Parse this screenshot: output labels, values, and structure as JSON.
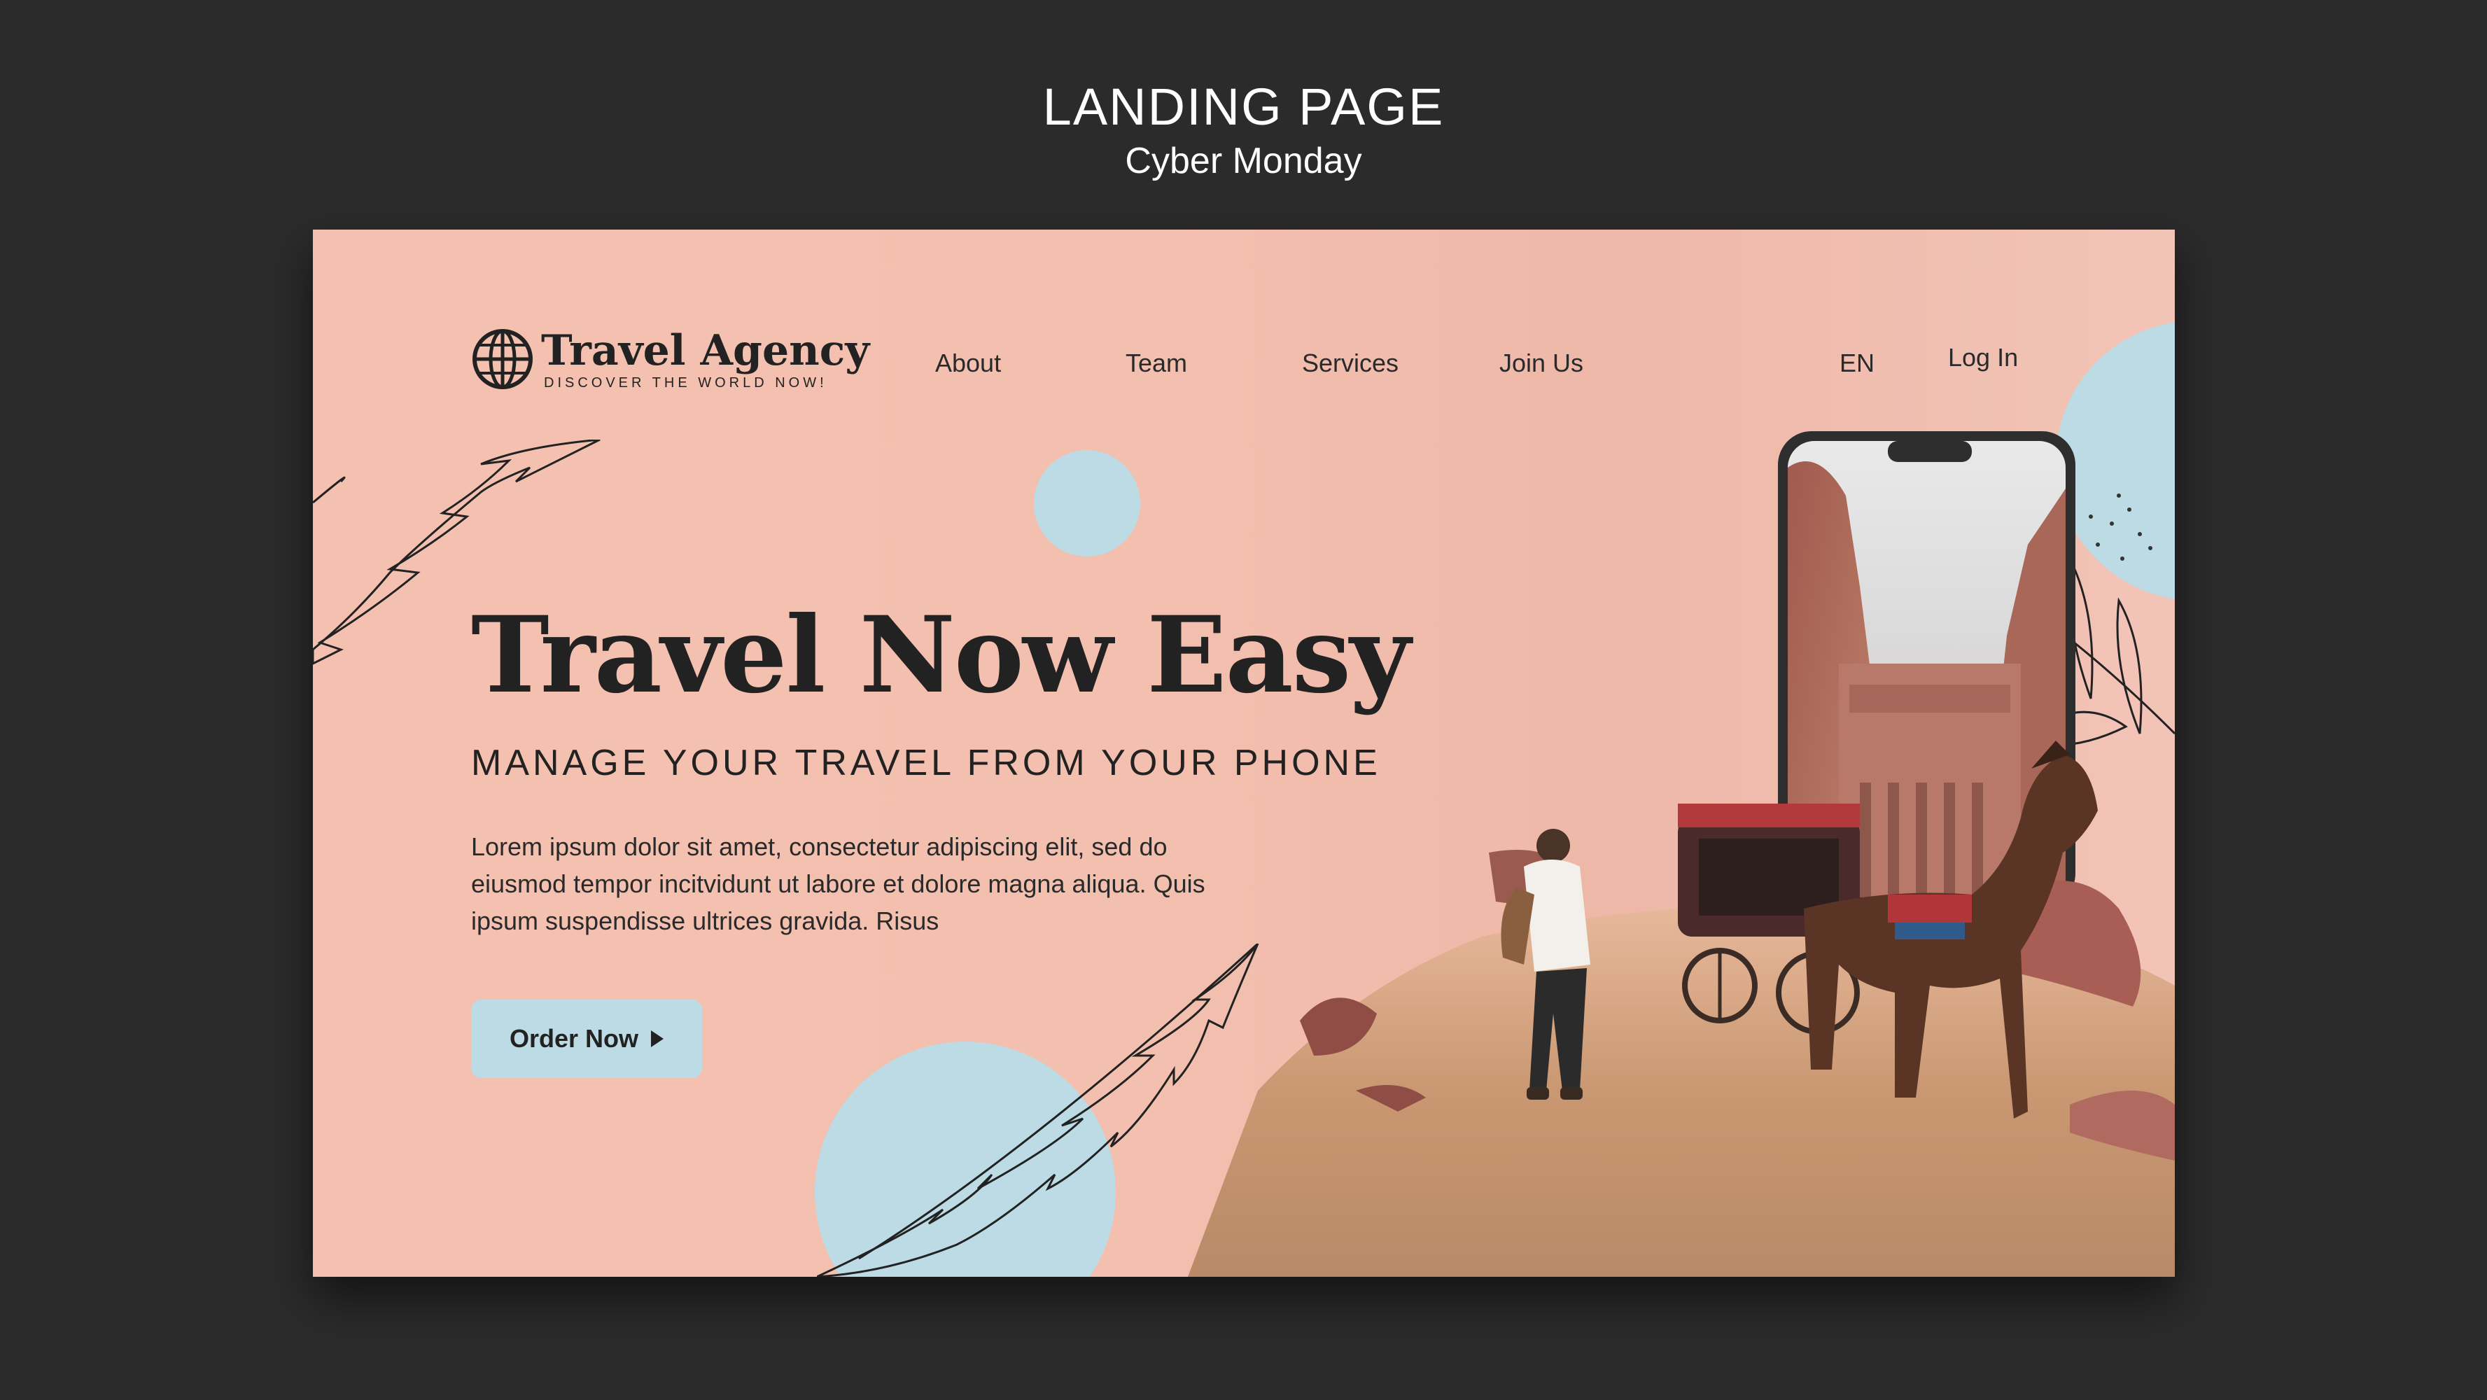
{
  "heading": {
    "title": "LANDING PAGE",
    "subtitle": "Cyber Monday"
  },
  "brand": {
    "name": "Travel Agency",
    "tagline": "DISCOVER THE WORLD NOW!",
    "icon": "globe-icon"
  },
  "nav": {
    "items": [
      "About",
      "Team",
      "Services",
      "Join Us"
    ],
    "language": "EN",
    "login": "Log In"
  },
  "hero": {
    "title": "Travel Now Easy",
    "subtitle": "MANAGE YOUR TRAVEL FROM YOUR PHONE",
    "body": "Lorem ipsum dolor sit amet, consectetur adipiscing elit, sed do eiusmod tempor incitvidunt ut labore et dolore magna aliqua. Quis ipsum suspendisse ultrices gravida. Risus",
    "cta": "Order Now",
    "cta_icon": "play-arrow-icon"
  },
  "colors": {
    "background": "#2b2b2b",
    "page_pink": "#f4c0b0",
    "accent_blue": "#bcdbe5",
    "text_dark": "#222222"
  }
}
